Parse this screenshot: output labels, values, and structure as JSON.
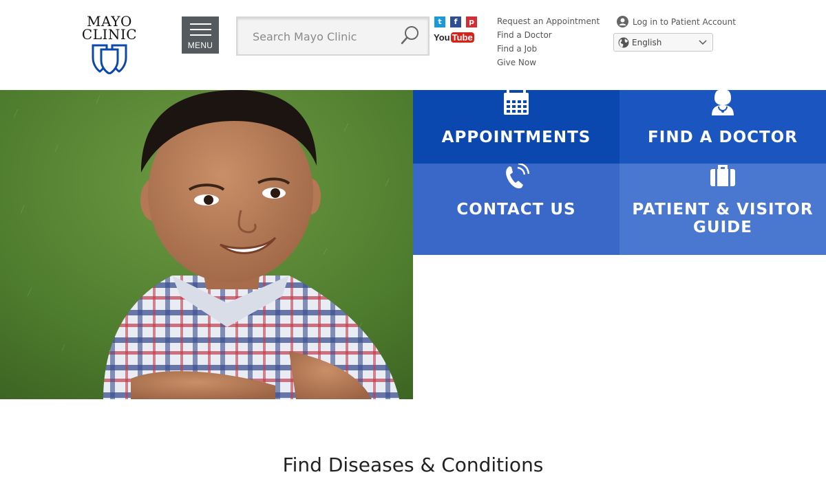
{
  "brand": {
    "line1": "MAYO",
    "line2": "CLINIC",
    "accent": "#0a48b0"
  },
  "menu": {
    "label": "MENU",
    "icon": "hamburger-icon"
  },
  "search": {
    "placeholder": "Search Mayo Clinic",
    "value": "",
    "icon": "search-icon"
  },
  "social": {
    "twitter": {
      "glyph": "t",
      "icon": "twitter-icon"
    },
    "facebook": {
      "glyph": "f",
      "icon": "facebook-icon"
    },
    "pinterest": {
      "glyph": "p",
      "icon": "pinterest-icon"
    },
    "youtube": {
      "you": "You",
      "tube": "Tube",
      "icon": "youtube-icon"
    }
  },
  "quick_links": {
    "request_appointment": "Request an Appointment",
    "find_doctor": "Find a Doctor",
    "find_job": "Find a Job",
    "give_now": "Give Now"
  },
  "account": {
    "login_label": "Log in to Patient Account",
    "icon": "user-icon"
  },
  "language": {
    "selected": "English",
    "icon": "globe-icon"
  },
  "hero": {
    "image": "boy-smiling-on-grass-photo",
    "tiles": {
      "appointments": {
        "label": "APPOINTMENTS",
        "icon": "calendar-icon",
        "color": "#0a48b0"
      },
      "find_doctor": {
        "label": "FIND A DOCTOR",
        "icon": "doctor-icon",
        "color": "#1a55c0"
      },
      "contact": {
        "label": "CONTACT US",
        "icon": "phone-icon",
        "color": "#3968c9"
      },
      "guide": {
        "label": "PATIENT & VISITOR GUIDE",
        "icon": "briefcase-icon",
        "color": "#4a78d1"
      }
    }
  },
  "sections": {
    "diseases_title": "Find Diseases & Conditions"
  }
}
